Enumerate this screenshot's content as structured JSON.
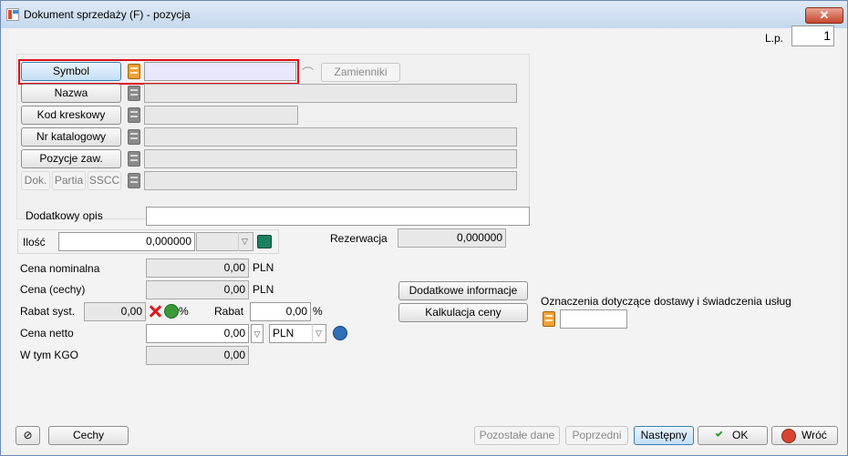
{
  "window": {
    "title": "Dokument sprzedaży (F) - pozycja",
    "close_label": "✕"
  },
  "lp": {
    "label": "L.p.",
    "value": "1"
  },
  "item": {
    "symbol_label": "Symbol",
    "symbol_value": "",
    "zamienniki_label": "Zamienniki",
    "nazwa_label": "Nazwa",
    "nazwa_value": "",
    "kod_label": "Kod kreskowy",
    "kod_value": "",
    "nrkat_label": "Nr katalogowy",
    "nrkat_value": "",
    "pozycje_label": "Pozycje zaw.",
    "pozycje_value": "",
    "dok_label": "Dok.",
    "partia_label": "Partia",
    "sscc_label": "SSCC",
    "sscc_value": ""
  },
  "details": {
    "opis_label": "Dodatkowy opis",
    "opis_value": "",
    "ilosc_label": "Ilość",
    "ilosc_value": "0,000000",
    "jm_value": "",
    "rezerwacja_label": "Rezerwacja",
    "rezerwacja_value": "0,000000"
  },
  "prices": {
    "nominal_label": "Cena nominalna",
    "nominal_value": "0,00",
    "nominal_currency": "PLN",
    "cechy_label": "Cena (cechy)",
    "cechy_value": "0,00",
    "cechy_currency": "PLN",
    "rabat_syst_label": "Rabat syst.",
    "rabat_syst_value": "0,00",
    "rabat_syst_pct": "%",
    "rabat_label": "Rabat",
    "rabat_value": "0,00",
    "rabat_pct": "%",
    "netto_label": "Cena netto",
    "netto_value": "0,00",
    "netto_currency": "PLN",
    "kgo_label": "W tym KGO",
    "kgo_value": "0,00"
  },
  "extra": {
    "dodatkowe_label": "Dodatkowe informacje",
    "kalkulacja_label": "Kalkulacja ceny",
    "oznaczenia_label": "Oznaczenia dotyczące dostawy i świadczenia usług",
    "oznaczenia_value": ""
  },
  "footer": {
    "cechy_label": "Cechy",
    "pozostale_label": "Pozostałe dane",
    "poprzedni_label": "Poprzedni",
    "nastepny_label": "Następny",
    "ok_label": "OK",
    "wroc_label": "Wróć"
  }
}
